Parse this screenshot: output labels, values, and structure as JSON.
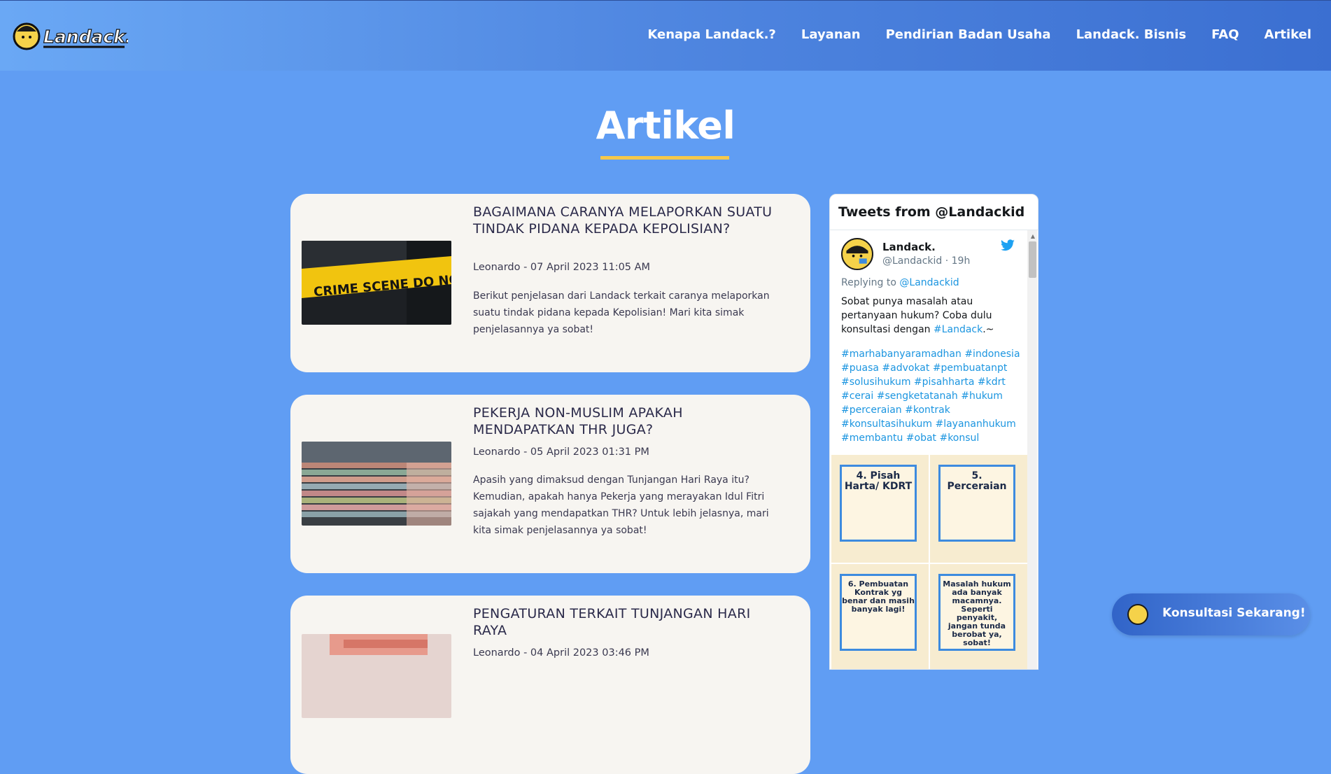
{
  "brand": {
    "logo_text": "Landack."
  },
  "nav": {
    "items": [
      "Kenapa Landack.?",
      "Layanan",
      "Pendirian Badan Usaha",
      "Landack. Bisnis",
      "FAQ",
      "Artikel"
    ]
  },
  "page": {
    "title": "Artikel"
  },
  "articles": [
    {
      "title": "BAGAIMANA CARANYA MELAPORKAN SUATU TINDAK PIDANA KEPADA KEPOLISIAN?",
      "meta": "Leonardo - 07 April 2023 11:05 AM",
      "excerpt": "Berikut penjelasan dari Landack terkait caranya melaporkan suatu tindak pidana kepada Kepolisian! Mari kita simak penjelasannya ya sobat!",
      "thumb_text": "CRIME SCENE DO NOT"
    },
    {
      "title": "PEKERJA NON-MUSLIM APAKAH MENDAPATKAN THR JUGA?",
      "meta": "Leonardo - 05 April 2023 01:31 PM",
      "excerpt": "Apasih yang dimaksud dengan Tunjangan Hari Raya itu? Kemudian, apakah hanya Pekerja yang merayakan Idul Fitri sajakah yang mendapatkan THR? Untuk lebih jelasnya, mari kita simak penjelasannya ya sobat!"
    },
    {
      "title": "PENGATURAN TERKAIT TUNJANGAN HARI RAYA",
      "meta": "Leonardo - 04 April 2023 03:46 PM"
    }
  ],
  "twitter": {
    "header": "Tweets from @Landackid",
    "name": "Landack.",
    "handle": "@Landackid · 19h",
    "replying_prefix": "Replying to ",
    "replying_to": "@Landackid",
    "text_before": "Sobat punya masalah atau pertanyaan hukum? Coba dulu konsultasi dengan ",
    "text_link": "#Landack",
    "text_after": ".~",
    "hashtags": "#marhabanyaramadhan #indonesia #puasa #advokat #pembuatanpt #solusihukum #pisahharta #kdrt #cerai #sengketatanah #hukum #perceraian #kontrak #konsultasihukum #layananhukum #membantu #obat #konsul",
    "tiles": [
      "4. Pisah Harta/ KDRT",
      "5. Perceraian",
      "6. Pembuatan Kontrak yg benar dan masih banyak lagi!",
      "Masalah hukum ada banyak macamnya. Seperti penyakit, jangan tunda berobat ya, sobat!"
    ]
  },
  "cta": {
    "label": "Konsultasi Sekarang!"
  },
  "colors": {
    "background": "#609df3",
    "accent_underline": "#f5c84b",
    "card": "#f7f5f1",
    "twitter_link": "#1b95e0"
  }
}
